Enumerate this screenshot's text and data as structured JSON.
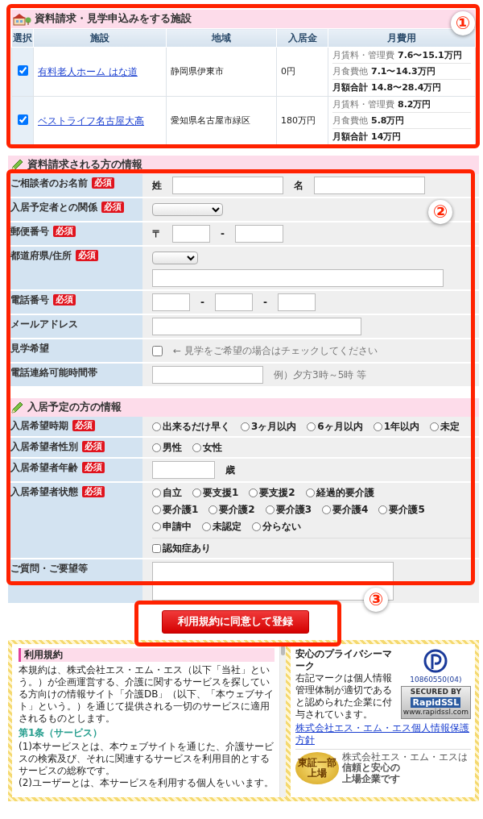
{
  "annotations": [
    {
      "label": "①"
    },
    {
      "label": "②"
    },
    {
      "label": "③"
    }
  ],
  "facilities": {
    "title": "資料請求・見学申込みをする施設",
    "columns": [
      "選択",
      "施設",
      "地域",
      "入居金",
      "月費用"
    ],
    "rows": [
      {
        "selected": true,
        "name": "有料老人ホーム はな道",
        "area": "静岡県伊東市",
        "entry_fee": "0円",
        "monthly": [
          {
            "kind": "item",
            "label": "月賃料・管理費",
            "value": "7.6〜15.1万円"
          },
          {
            "kind": "item",
            "label": "月食費他",
            "value": "7.1〜14.3万円"
          },
          {
            "kind": "total",
            "label": "月額合計",
            "value": "14.8〜28.4万円"
          }
        ]
      },
      {
        "selected": true,
        "name": "ベストライフ名古屋大高",
        "area": "愛知県名古屋市緑区",
        "entry_fee": "180万円",
        "monthly": [
          {
            "kind": "item",
            "label": "月賃料・管理費",
            "value": "8.2万円"
          },
          {
            "kind": "item",
            "label": "月食費他",
            "value": "5.8万円"
          },
          {
            "kind": "total",
            "label": "月額合計",
            "value": "14万円"
          }
        ]
      }
    ]
  },
  "requester": {
    "title": "資料請求される方の情報",
    "rows": [
      {
        "label": "ご相談者のお名前",
        "badge": "必須",
        "lines": [
          {
            "items": [
              {
                "kind": "prefix",
                "text": "姓"
              },
              {
                "kind": "name"
              },
              {
                "kind": "prefix",
                "text": "名"
              },
              {
                "kind": "name"
              }
            ]
          }
        ]
      },
      {
        "label": "入居予定者との関係",
        "badge": "必須",
        "lines": [
          {
            "items": [
              {
                "kind": "relation"
              }
            ]
          }
        ]
      },
      {
        "label": "郵便番号",
        "badge": "必須",
        "lines": [
          {
            "items": [
              {
                "kind": "prefix",
                "text": "〒"
              },
              {
                "kind": "zip"
              },
              {
                "kind": "prefix",
                "text": "-"
              },
              {
                "kind": "zipext"
              }
            ]
          }
        ]
      },
      {
        "label": "都道府県/住所",
        "badge": "必須",
        "lines": [
          {
            "items": [
              {
                "kind": "prefecture"
              }
            ]
          },
          {
            "items": [
              {
                "kind": "address"
              }
            ]
          }
        ]
      },
      {
        "label": "電話番号",
        "badge": "必須",
        "lines": [
          {
            "items": [
              {
                "kind": "phone"
              },
              {
                "kind": "prefix",
                "text": "-"
              },
              {
                "kind": "phone"
              },
              {
                "kind": "prefix",
                "text": "-"
              },
              {
                "kind": "phone"
              }
            ]
          }
        ]
      },
      {
        "label": "メールアドレス",
        "lines": [
          {
            "items": [
              {
                "kind": "email"
              }
            ]
          }
        ]
      },
      {
        "label": "見学希望",
        "lines": [
          {
            "items": [
              {
                "kind": "checkbox",
                "checked": false
              },
              {
                "kind": "note",
                "text": "← 見学をご希望の場合はチェックしてください"
              }
            ]
          }
        ]
      },
      {
        "label": "電話連絡可能時間帯",
        "lines": [
          {
            "items": [
              {
                "kind": "time"
              },
              {
                "kind": "note",
                "text": "例）夕方3時～5時 等"
              }
            ]
          }
        ]
      }
    ]
  },
  "resident": {
    "title": "入居予定の方の情報",
    "rows": [
      {
        "label": "入居希望時期",
        "badge": "必須",
        "lines": [
          {
            "items": [
              {
                "kind": "radio",
                "text": "出来るだけ早く",
                "selected": false
              },
              {
                "kind": "radio",
                "text": "3ヶ月以内",
                "selected": false
              },
              {
                "kind": "radio",
                "text": "6ヶ月以内",
                "selected": false
              },
              {
                "kind": "radio",
                "text": "1年以内",
                "selected": false
              },
              {
                "kind": "radio",
                "text": "未定",
                "selected": false
              }
            ]
          }
        ]
      },
      {
        "label": "入居希望者性別",
        "badge": "必須",
        "lines": [
          {
            "items": [
              {
                "kind": "radio",
                "text": "男性",
                "selected": false
              },
              {
                "kind": "radio",
                "text": "女性",
                "selected": false
              }
            ]
          }
        ]
      },
      {
        "label": "入居希望者年齢",
        "badge": "必須",
        "lines": [
          {
            "items": [
              {
                "kind": "age"
              },
              {
                "kind": "prefix",
                "text": "歳"
              }
            ]
          }
        ]
      },
      {
        "label": "入居希望者状態",
        "badge": "必須",
        "lines": [
          {
            "items": [
              {
                "kind": "radio",
                "text": "自立",
                "selected": false
              },
              {
                "kind": "radio",
                "text": "要支援1",
                "selected": false
              },
              {
                "kind": "radio",
                "text": "要支援2",
                "selected": false
              },
              {
                "kind": "radio",
                "text": "経過的要介護",
                "selected": false
              }
            ]
          },
          {
            "items": [
              {
                "kind": "radio",
                "text": "要介護1",
                "selected": false
              },
              {
                "kind": "radio",
                "text": "要介護2",
                "selected": false
              },
              {
                "kind": "radio",
                "text": "要介護3",
                "selected": false
              },
              {
                "kind": "radio",
                "text": "要介護4",
                "selected": false
              },
              {
                "kind": "radio",
                "text": "要介護5",
                "selected": false
              }
            ]
          },
          {
            "items": [
              {
                "kind": "radio",
                "text": "申請中",
                "selected": false
              },
              {
                "kind": "radio",
                "text": "未認定",
                "selected": false
              },
              {
                "kind": "radio",
                "text": "分らない",
                "selected": false
              }
            ]
          },
          {
            "separated": true,
            "items": [
              {
                "kind": "checkbox",
                "text": "認知症あり",
                "checked": false
              }
            ]
          }
        ]
      },
      {
        "label": "ご質問・ご要望等",
        "lines": [
          {
            "items": [
              {
                "kind": "textarea"
              }
            ]
          }
        ]
      }
    ]
  },
  "submit": {
    "label": "利用規約に同意して登録"
  },
  "terms": {
    "title": "利用規約",
    "blocks": [
      {
        "kind": "paragraph",
        "text": "本規約は、株式会社エス・エム・エス（以下「当社」という。）が企画運営する、介護に関するサービスを探している方向けの情報サイト「介護DB」（以下、「本ウェブサイト」という。）を通じて提供される一切のサービスに適用されるものとします。"
      },
      {
        "kind": "heading",
        "text": "第1条（サービス）"
      },
      {
        "kind": "paragraph",
        "text": "(1)本サービスとは、本ウェブサイトを通じた、介護サービスの検索及び、それに関連するサービスを利用目的とするサービスの総称です。"
      },
      {
        "kind": "paragraph",
        "text": "(2)ユーザーとは、本サービスを利用する個人をいいます。"
      }
    ]
  },
  "privacy": {
    "title": "安心のプライバシーマーク",
    "text": "右記マークは個人情報管理体制が適切であると認められた企業に付与されています。",
    "link": "株式会社エス・エム・エス個人情報保護方針",
    "mark_number": "10860550(04)",
    "listing_medal": [
      "東証一部",
      "上場"
    ],
    "listing_text": [
      "株式会社エス・エム・エスは",
      "信頼と安心の",
      "上場企業です"
    ],
    "ssl_badge": [
      "SECURED BY",
      "RapidSSL",
      "www.rapidssl.com"
    ]
  }
}
